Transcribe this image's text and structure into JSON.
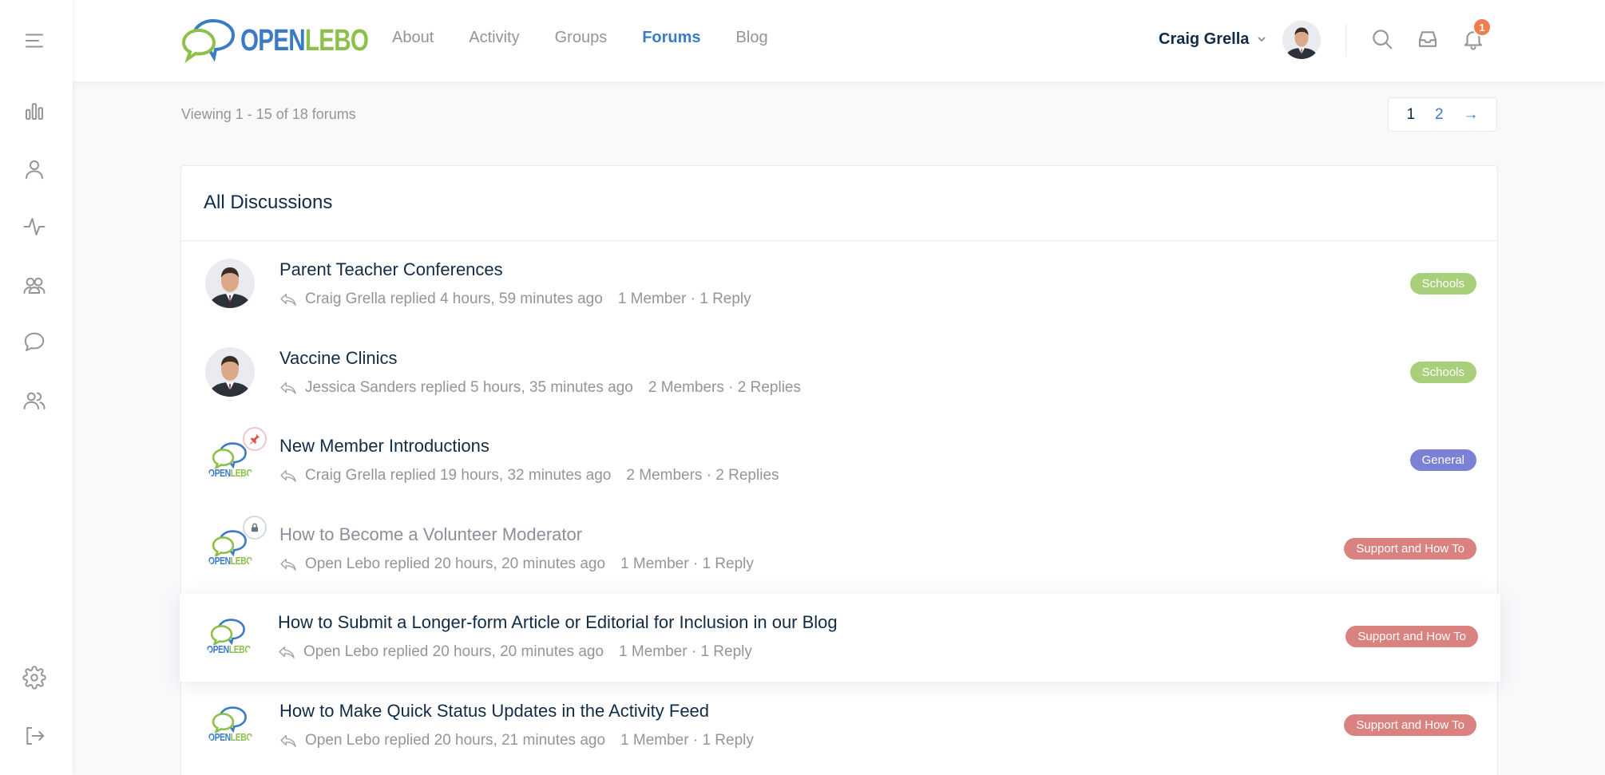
{
  "brand": {
    "open": "OPEN",
    "lebo": "LEBO"
  },
  "nav": [
    {
      "label": "About",
      "active": false
    },
    {
      "label": "Activity",
      "active": false
    },
    {
      "label": "Groups",
      "active": false
    },
    {
      "label": "Forums",
      "active": true
    },
    {
      "label": "Blog",
      "active": false
    }
  ],
  "user": {
    "name": "Craig Grella"
  },
  "notifications": {
    "count": "1"
  },
  "sidebar_icons": [
    "menu-icon",
    "stats-icon",
    "profile-icon",
    "activity-icon",
    "groups-icon",
    "forums-icon",
    "members-icon",
    "settings-icon",
    "logout-icon"
  ],
  "listing": {
    "viewing": "Viewing 1 - 15 of 18 forums"
  },
  "pager": {
    "current": "1",
    "next_page": "2",
    "next_arrow": "→"
  },
  "card": {
    "title": "All Discussions"
  },
  "colors": {
    "accent": "#3a7bc8",
    "schools": "#a8d07a",
    "general": "#7b82d6",
    "support": "#d9827f"
  },
  "discussions": [
    {
      "title": "Parent Teacher Conferences",
      "reply": "Craig Grella replied 4 hours, 59 minutes ago",
      "counts": "1 Member · 1 Reply",
      "tag": "Schools",
      "tag_color": "#a8d07a",
      "avatar": "person",
      "badge": ""
    },
    {
      "title": "Vaccine Clinics",
      "reply": "Jessica Sanders replied 5 hours, 35 minutes ago",
      "counts": "2 Members · 2 Replies",
      "tag": "Schools",
      "tag_color": "#a8d07a",
      "avatar": "person",
      "badge": ""
    },
    {
      "title": "New Member Introductions",
      "reply": "Craig Grella replied 19 hours, 32 minutes ago",
      "counts": "2 Members · 2 Replies",
      "tag": "General",
      "tag_color": "#7b82d6",
      "avatar": "logo",
      "badge": "pin"
    },
    {
      "title": "How to Become a Volunteer Moderator",
      "reply": "Open Lebo replied 20 hours, 20 minutes ago",
      "counts": "1 Member · 1 Reply",
      "tag": "Support and How To",
      "tag_color": "#d9827f",
      "avatar": "logo",
      "badge": "lock"
    },
    {
      "title": "How to Submit a Longer-form Article or Editorial for Inclusion in our Blog",
      "reply": "Open Lebo replied 20 hours, 20 minutes ago",
      "counts": "1 Member · 1 Reply",
      "tag": "Support and How To",
      "tag_color": "#d9827f",
      "avatar": "logo",
      "badge": ""
    },
    {
      "title": "How to Make Quick Status Updates in the Activity Feed",
      "reply": "Open Lebo replied 20 hours, 21 minutes ago",
      "counts": "1 Member · 1 Reply",
      "tag": "Support and How To",
      "tag_color": "#d9827f",
      "avatar": "logo",
      "badge": ""
    }
  ]
}
